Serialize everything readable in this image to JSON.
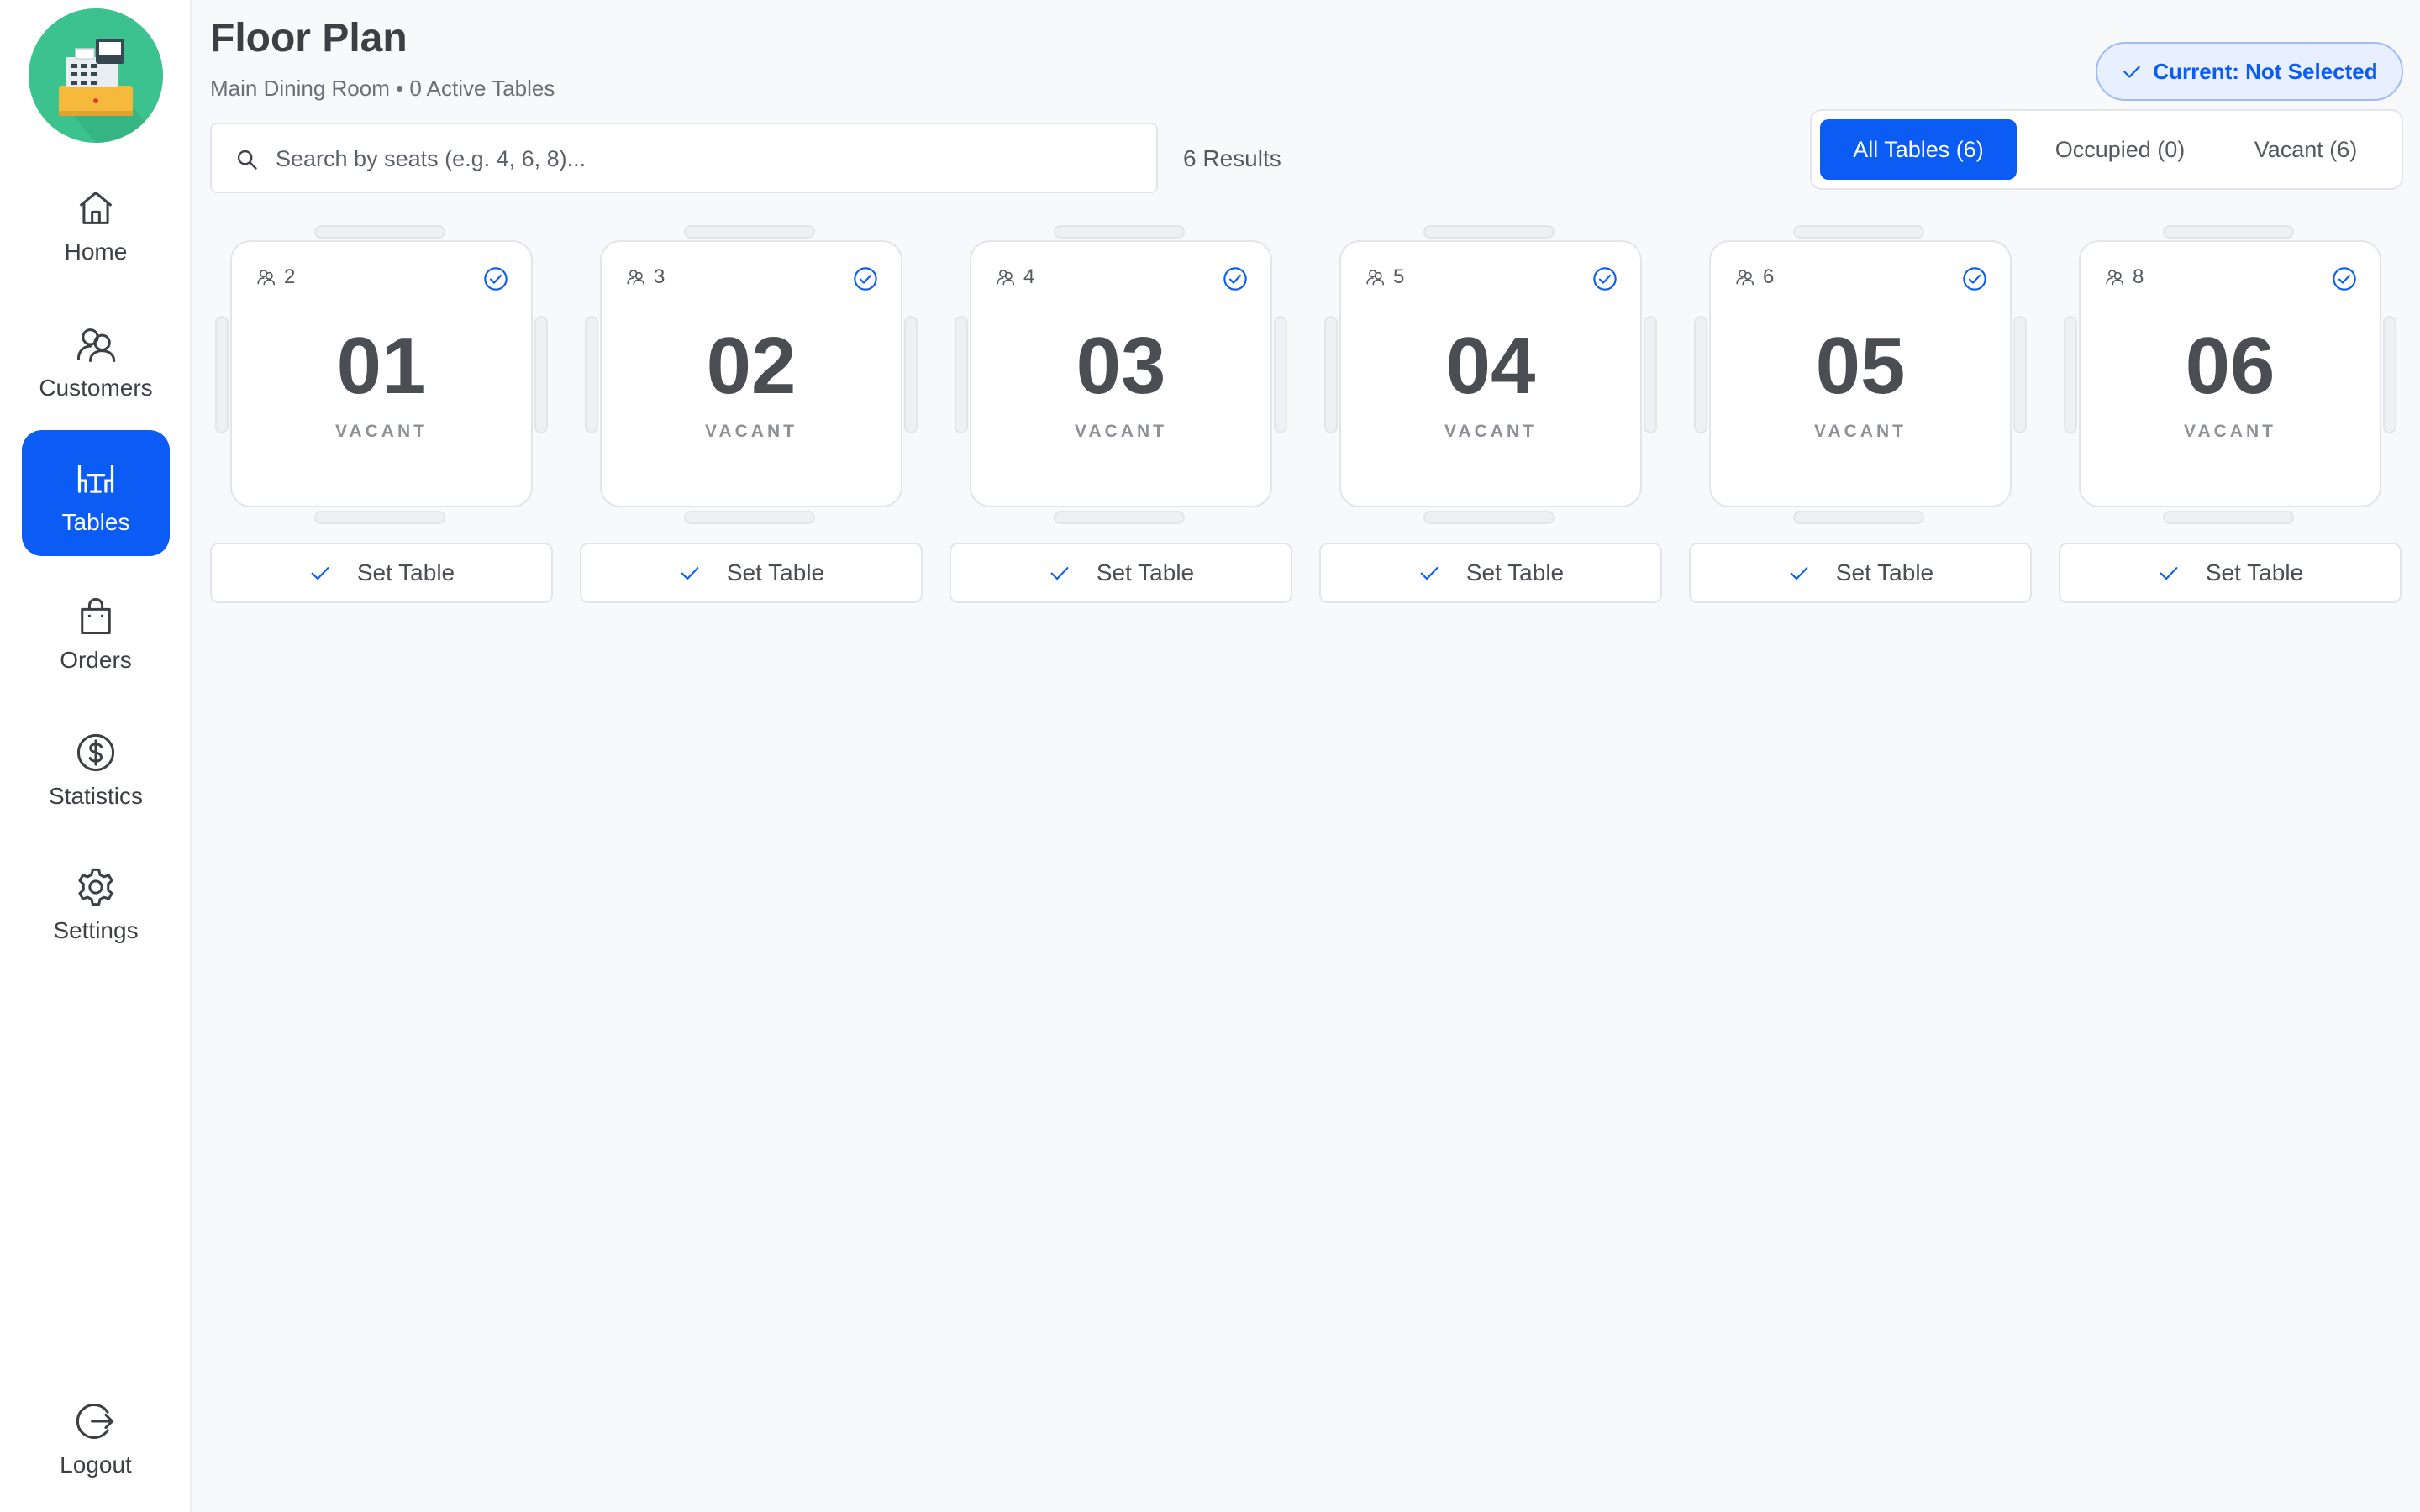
{
  "header": {
    "title": "Floor Plan",
    "subtitle": "Main Dining Room • 0 Active Tables",
    "current_badge": "Current: Not Selected"
  },
  "sidebar": {
    "logo_icon": "cash-register-icon",
    "items": [
      {
        "label": "Home",
        "icon": "home-icon"
      },
      {
        "label": "Customers",
        "icon": "users-icon"
      },
      {
        "label": "Tables",
        "icon": "dining-table-icon",
        "active": true
      },
      {
        "label": "Orders",
        "icon": "shopping-bag-icon"
      },
      {
        "label": "Statistics",
        "icon": "dollar-circle-icon"
      },
      {
        "label": "Settings",
        "icon": "gear-icon"
      }
    ],
    "logout": {
      "label": "Logout",
      "icon": "logout-icon"
    }
  },
  "search": {
    "placeholder": "Search by seats (e.g. 4, 6, 8)...",
    "value": "",
    "results": "6 Results"
  },
  "filters": [
    {
      "label": "All Tables (6)",
      "active": true
    },
    {
      "label": "Occupied (0)",
      "active": false
    },
    {
      "label": "Vacant (6)",
      "active": false
    }
  ],
  "tables": [
    {
      "number": "01",
      "seats": "2",
      "status": "VACANT",
      "action": "Set Table"
    },
    {
      "number": "02",
      "seats": "3",
      "status": "VACANT",
      "action": "Set Table"
    },
    {
      "number": "03",
      "seats": "4",
      "status": "VACANT",
      "action": "Set Table"
    },
    {
      "number": "04",
      "seats": "5",
      "status": "VACANT",
      "action": "Set Table"
    },
    {
      "number": "05",
      "seats": "6",
      "status": "VACANT",
      "action": "Set Table"
    },
    {
      "number": "06",
      "seats": "8",
      "status": "VACANT",
      "action": "Set Table"
    }
  ],
  "colors": {
    "accent": "#0a5cf5",
    "logo_bg": "#3cc28e",
    "background": "#f8f9fb"
  }
}
